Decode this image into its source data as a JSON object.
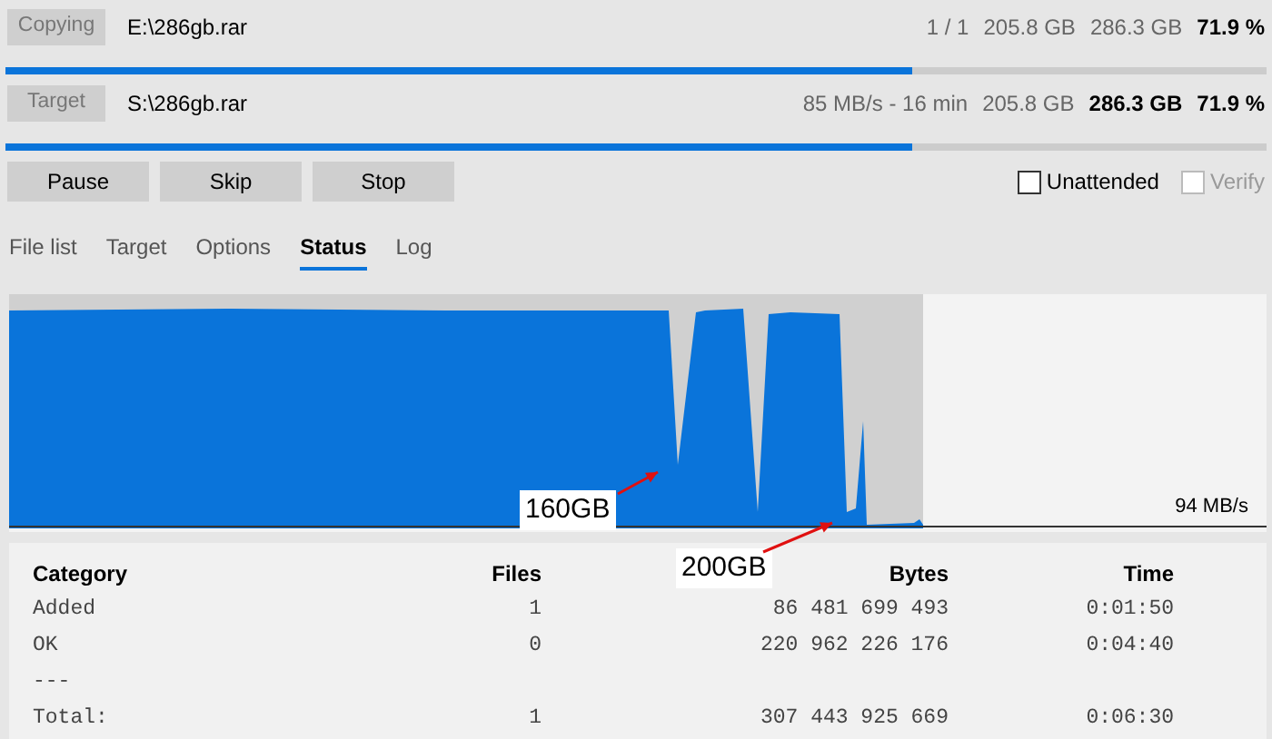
{
  "transfers": [
    {
      "label": "Copying",
      "path": "E:\\286gb.rar",
      "stats": [
        {
          "text": "1 / 1",
          "emphasis": false
        },
        {
          "text": "205.8 GB",
          "emphasis": false
        },
        {
          "text": "286.3 GB",
          "emphasis": false
        },
        {
          "text": "71.9 %",
          "emphasis": true
        }
      ],
      "level": 0.719
    },
    {
      "label": "Target",
      "path": "S:\\286gb.rar",
      "stats": [
        {
          "text": "85 MB/s - 16 min",
          "emphasis": false
        },
        {
          "text": "205.8 GB",
          "emphasis": false
        },
        {
          "text": "286.3 GB",
          "emphasis": true
        },
        {
          "text": "71.9 %",
          "emphasis": true
        }
      ],
      "level": 0.719
    }
  ],
  "buttons": [
    "Pause",
    "Skip",
    "Stop"
  ],
  "options": [
    {
      "label": "Unattended",
      "checked": false,
      "disabled": false
    },
    {
      "label": "Verify",
      "checked": false,
      "disabled": true
    }
  ],
  "tabs": [
    {
      "label": "File list",
      "selected": false
    },
    {
      "label": "Target",
      "selected": false
    },
    {
      "label": "Options",
      "selected": false
    },
    {
      "label": "Status",
      "selected": true
    },
    {
      "label": "Log",
      "selected": false
    }
  ],
  "graph": {
    "speed": "94 MB/s",
    "annotations": [
      {
        "label": "160GB"
      },
      {
        "label": "200GB"
      }
    ]
  },
  "table": {
    "columns": [
      "Category",
      "Files",
      "Bytes",
      "Time"
    ],
    "rows": [
      {
        "kind": "data",
        "cells": [
          "Added",
          "1",
          "86 481 699 493",
          "0:01:50"
        ]
      },
      {
        "kind": "data",
        "cells": [
          "OK",
          "0",
          "220 962 226 176",
          "0:04:40"
        ]
      },
      {
        "kind": "separator",
        "cells": [
          "---"
        ]
      },
      {
        "kind": "data",
        "cells": [
          "Total:",
          "1",
          "307 443 925 669",
          "0:06:30"
        ]
      }
    ]
  }
}
